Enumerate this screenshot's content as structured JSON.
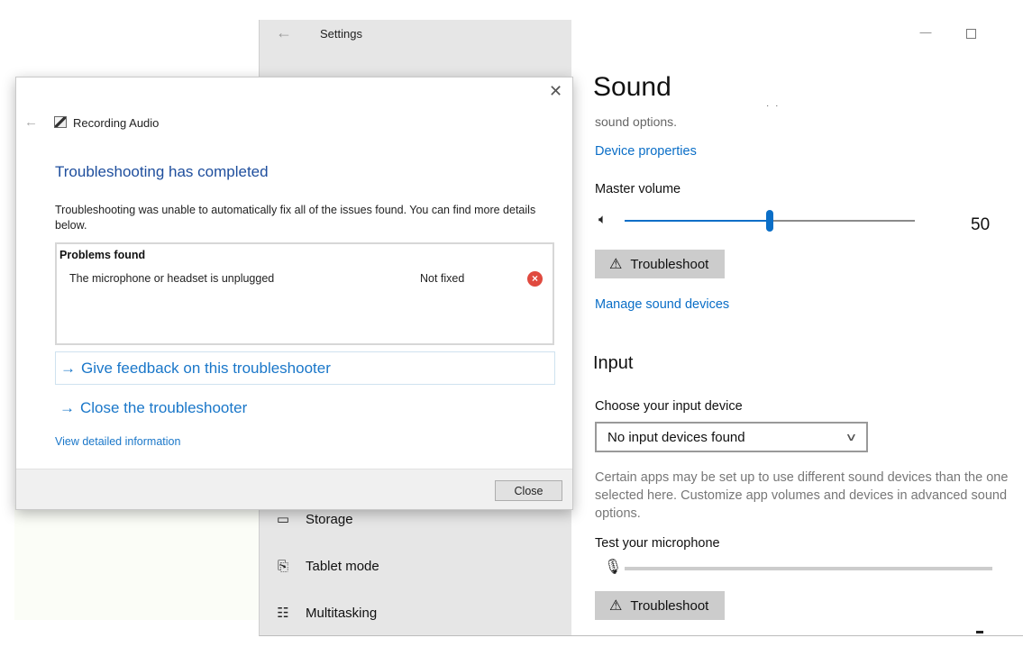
{
  "settings": {
    "title": "Settings",
    "back_icon": "←",
    "window_controls": {
      "minimize": "—"
    },
    "nav_items": [
      {
        "label": "Storage",
        "icon": "storage-icon",
        "glyph": "▭"
      },
      {
        "label": "Tablet mode",
        "icon": "tablet-mode-icon",
        "glyph": "⎘"
      },
      {
        "label": "Multitasking",
        "icon": "multitasking-icon",
        "glyph": "☷"
      }
    ],
    "content": {
      "page_title": "Sound",
      "stray_dots": "· ·",
      "output_desc_tail": "sound options.",
      "device_properties_link": "Device properties",
      "master_volume_label": "Master volume",
      "master_volume_value": 50,
      "master_volume_value_text": "50",
      "troubleshoot_label": "Troubleshoot",
      "warning_glyph": "⚠",
      "manage_devices_link": "Manage sound devices",
      "input_section_title": "Input",
      "choose_input_label": "Choose your input device",
      "input_device_selected": "No input devices found",
      "input_description": "Certain apps may be set up to use different sound devices than the one selected here. Customize app volumes and devices in advanced sound options.",
      "test_mic_label": "Test your microphone",
      "mic_level": 0,
      "input_troubleshoot_label": "Troubleshoot"
    }
  },
  "dialog": {
    "close_glyph": "✕",
    "back_glyph": "←",
    "app_title": "Recording Audio",
    "heading": "Troubleshooting has completed",
    "message": "Troubleshooting was unable to automatically fix all of the issues found. You can find more details below.",
    "problems_header": "Problems found",
    "problems": [
      {
        "description": "The microphone or headset is unplugged",
        "status": "Not fixed",
        "status_icon": "error-icon"
      }
    ],
    "feedback_link": "Give feedback on this troubleshooter",
    "close_troubleshooter_link": "Close the troubleshooter",
    "arrow_glyph": "→",
    "detail_link": "View detailed information",
    "close_button": "Close"
  },
  "colors": {
    "accent": "#0a6ec7",
    "dialog_heading": "#1e4e9d",
    "error": "#e04a3f",
    "nav_bg": "#e6e6e6"
  }
}
